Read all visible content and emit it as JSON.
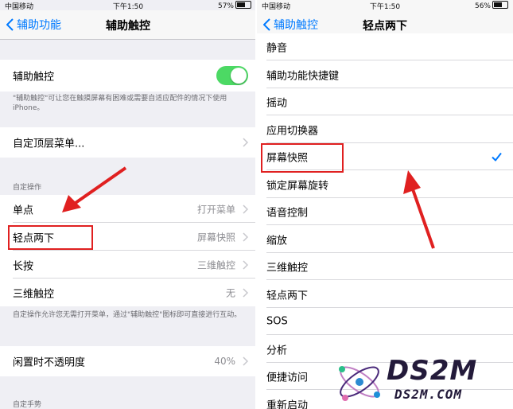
{
  "left": {
    "status": {
      "carrier": "中国移动",
      "time": "下午1:50",
      "battery": "57%",
      "battery_level": 0.57
    },
    "nav": {
      "back": "辅助功能",
      "title": "辅助触控"
    },
    "toggle_row": {
      "label": "辅助触控",
      "on": true
    },
    "toggle_note": "\"辅助触控\"可让您在触摸屏幕有困难或需要自适应配件的情况下使用 iPhone。",
    "custom_menu": "自定顶层菜单...",
    "section_custom_actions": "自定操作",
    "actions": [
      {
        "label": "单点",
        "value": "打开菜单"
      },
      {
        "label": "轻点两下",
        "value": "屏幕快照"
      },
      {
        "label": "长按",
        "value": "三维触控"
      },
      {
        "label": "三维触控",
        "value": "无"
      }
    ],
    "actions_note": "自定操作允许您无需打开菜单，通过\"辅助触控\"图标即可直接进行互动。",
    "opacity": {
      "label": "闲置时不透明度",
      "value": "40%"
    },
    "section_custom_gestures": "自定手势"
  },
  "right": {
    "status": {
      "carrier": "中国移动",
      "time": "下午1:50",
      "battery": "56%",
      "battery_level": 0.56
    },
    "nav": {
      "back": "辅助触控",
      "title": "轻点两下"
    },
    "options": [
      "静音",
      "辅助功能快捷键",
      "摇动",
      "应用切换器",
      "屏幕快照",
      "锁定屏幕旋转",
      "语音控制",
      "缩放",
      "三维触控",
      "轻点两下",
      "SOS",
      "分析",
      "便捷访问",
      "重新启动"
    ],
    "selected": "屏幕快照"
  },
  "watermark": {
    "brand": "DS2M",
    "site": "DS2M.COM"
  },
  "colors": {
    "accent": "#007aff",
    "toggle_on": "#4cd964",
    "annotation_red": "#e02020"
  }
}
